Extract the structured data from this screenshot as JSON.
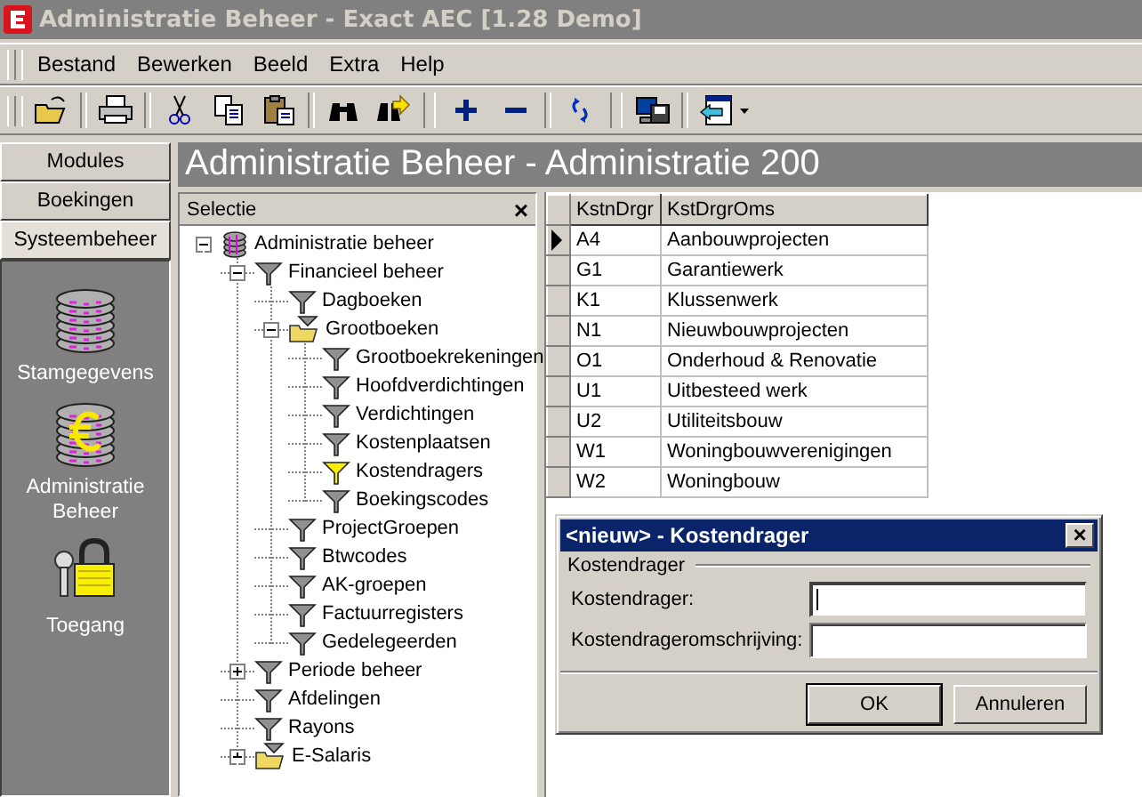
{
  "window": {
    "title": "Administratie Beheer - Exact AEC [1.28 Demo]",
    "active": false
  },
  "menu": [
    "Bestand",
    "Bewerken",
    "Beeld",
    "Extra",
    "Help"
  ],
  "sidebar": {
    "tabs": [
      {
        "label": "Modules",
        "selected": false
      },
      {
        "label": "Boekingen",
        "selected": false
      },
      {
        "label": "Systeembeheer",
        "selected": true
      }
    ],
    "items": [
      {
        "label": "Stamgegevens",
        "kind": "database"
      },
      {
        "label": "Administratie Beheer",
        "kind": "euro"
      },
      {
        "label": "Toegang",
        "kind": "lock"
      }
    ]
  },
  "header": "Administratie Beheer - Administratie 200",
  "tree": {
    "title": "Selectie",
    "close": "×",
    "items": [
      {
        "label": "Administratie beheer",
        "kind": "root",
        "selected": false,
        "expanded": true,
        "children": [
          {
            "label": "Financieel beheer",
            "kind": "filter",
            "selected": false,
            "expanded": true,
            "children": [
              {
                "label": "Dagboeken",
                "kind": "filter",
                "selected": false
              },
              {
                "label": "Grootboeken",
                "kind": "folder",
                "selected": false,
                "expanded": true,
                "children": [
                  {
                    "label": "Grootboekrekeningen",
                    "kind": "filter",
                    "selected": false
                  },
                  {
                    "label": "Hoofdverdichtingen",
                    "kind": "filter",
                    "selected": false
                  },
                  {
                    "label": "Verdichtingen",
                    "kind": "filter",
                    "selected": false
                  },
                  {
                    "label": "Kostenplaatsen",
                    "kind": "filter",
                    "selected": false
                  },
                  {
                    "label": "Kostendragers",
                    "kind": "filter",
                    "selected": true
                  },
                  {
                    "label": "Boekingscodes",
                    "kind": "filter",
                    "selected": false
                  }
                ]
              },
              {
                "label": "ProjectGroepen",
                "kind": "filter",
                "selected": false
              },
              {
                "label": "Btwcodes",
                "kind": "filter",
                "selected": false
              },
              {
                "label": "AK-groepen",
                "kind": "filter",
                "selected": false
              },
              {
                "label": "Factuurregisters",
                "kind": "filter",
                "selected": false
              },
              {
                "label": "Gedelegeerden",
                "kind": "filter",
                "selected": false
              }
            ]
          },
          {
            "label": "Periode beheer",
            "kind": "filter",
            "selected": false,
            "expanded": false
          },
          {
            "label": "Afdelingen",
            "kind": "filter",
            "selected": false
          },
          {
            "label": "Rayons",
            "kind": "filter",
            "selected": false
          },
          {
            "label": "E-Salaris",
            "kind": "folder",
            "selected": false,
            "expanded": false
          }
        ]
      }
    ]
  },
  "table": {
    "columns": [
      "KstnDrgr",
      "KstDrgrOms"
    ],
    "rows": [
      {
        "cells": [
          "A4",
          "Aanbouwprojecten"
        ],
        "selected": true
      },
      {
        "cells": [
          "G1",
          "Garantiewerk"
        ],
        "selected": false
      },
      {
        "cells": [
          "K1",
          "Klussenwerk"
        ],
        "selected": false
      },
      {
        "cells": [
          "N1",
          "Nieuwbouwprojecten"
        ],
        "selected": false
      },
      {
        "cells": [
          "O1",
          "Onderhoud & Renovatie"
        ],
        "selected": false
      },
      {
        "cells": [
          "U1",
          "Uitbesteed werk"
        ],
        "selected": false
      },
      {
        "cells": [
          "U2",
          "Utiliteitsbouw"
        ],
        "selected": false
      },
      {
        "cells": [
          "W1",
          "Woningbouwverenigingen"
        ],
        "selected": false
      },
      {
        "cells": [
          "W2",
          "Woningbouw"
        ],
        "selected": false
      }
    ]
  },
  "dialog": {
    "title": "<nieuw> - Kostendrager",
    "close": "×",
    "group": "Kostendrager",
    "fields": [
      {
        "label": "Kostendrager:",
        "focused": true
      },
      {
        "label": "Kostendrageromschrijving:",
        "focused": false
      }
    ],
    "buttons": [
      {
        "label": "OK",
        "default": true
      },
      {
        "label": "Annuleren",
        "default": false
      }
    ]
  }
}
